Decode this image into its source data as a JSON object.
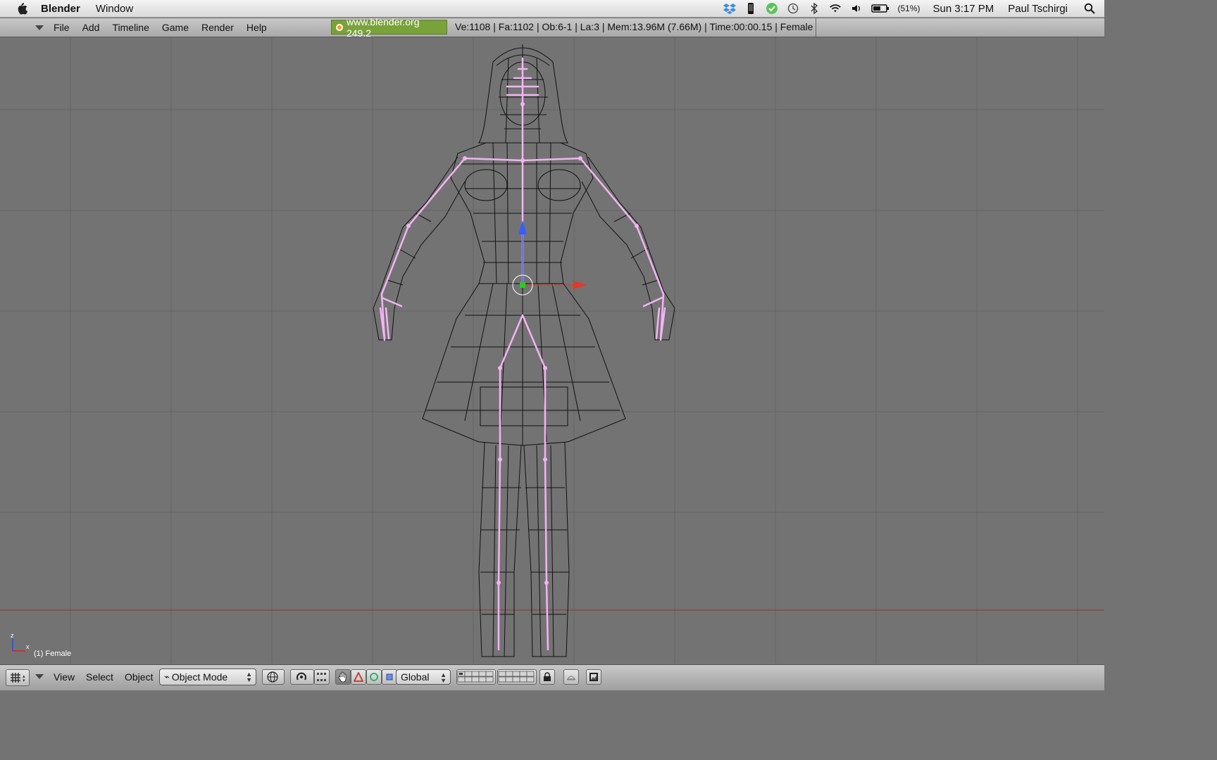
{
  "mac_menu": {
    "app_name": "Blender",
    "items": [
      "Window"
    ],
    "battery": "(51%)",
    "clock": "Sun 3:17 PM",
    "user": "Paul Tschirgi"
  },
  "blender_header": {
    "menus": [
      "File",
      "Add",
      "Timeline",
      "Game",
      "Render",
      "Help"
    ],
    "url_badge": "www.blender.org 249.2",
    "stats": "Ve:1108 | Fa:1102 | Ob:6-1 | La:3  | Mem:13.96M (7.66M)  | Time:00:00.15 | Female"
  },
  "viewport": {
    "object_label": "(1) Female",
    "axis_z": "z",
    "axis_x": "x",
    "colors": {
      "background": "#737373",
      "grid": "#656565",
      "armature": "#f3b4f3",
      "wire": "#111111",
      "x_axis_line": "#8a3a3a"
    }
  },
  "bottom_header": {
    "menus": [
      "View",
      "Select",
      "Object"
    ],
    "mode": "Object Mode",
    "orientation": "Global"
  }
}
